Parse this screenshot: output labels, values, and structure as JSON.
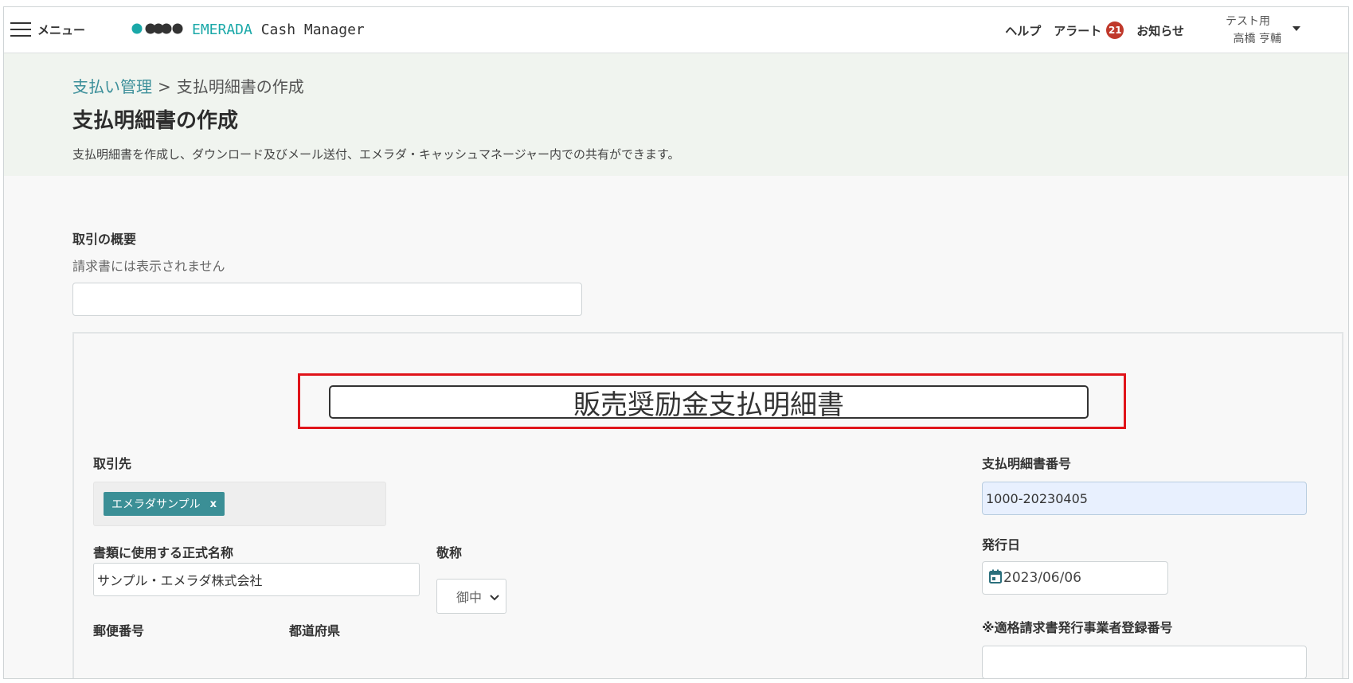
{
  "header": {
    "menu_label": "メニュー",
    "logo_brand": "EMERADA",
    "logo_product": " Cash Manager",
    "help": "ヘルプ",
    "alert": "アラート",
    "alert_count": "21",
    "notices": "お知らせ",
    "user_group": "テスト用",
    "user_name": "高橋 亨輔"
  },
  "page": {
    "breadcrumb_parent": "支払い管理",
    "breadcrumb_sep": ">",
    "breadcrumb_current": "支払明細書の作成",
    "title": "支払明細書の作成",
    "description": "支払明細書を作成し、ダウンロード及びメール送付、エメラダ・キャッシュマネージャー内での共有ができます。"
  },
  "summary": {
    "label": "取引の概要",
    "sub": "請求書には表示されません",
    "value": ""
  },
  "document": {
    "title_value": "販売奨励金支払明細書",
    "partner_label": "取引先",
    "partner_tag": "エメラダサンプル",
    "partner_remove": "x",
    "official_name_label": "書類に使用する正式名称",
    "official_name_value": "サンプル・エメラダ株式会社",
    "honorific_label": "敬称",
    "honorific_value": "御中",
    "postal_label": "郵便番号",
    "prefecture_label": "都道府県",
    "number_label": "支払明細書番号",
    "number_value": "1000-20230405",
    "issue_date_label": "発行日",
    "issue_date_value": "2023/06/06",
    "registration_label": "※適格請求書発行事業者登録番号"
  },
  "colors": {
    "brand": "#1aa8a8",
    "link": "#3c8f9a",
    "tag": "#3b8f96",
    "badge": "#c0392b",
    "highlight": "#e0141a"
  }
}
